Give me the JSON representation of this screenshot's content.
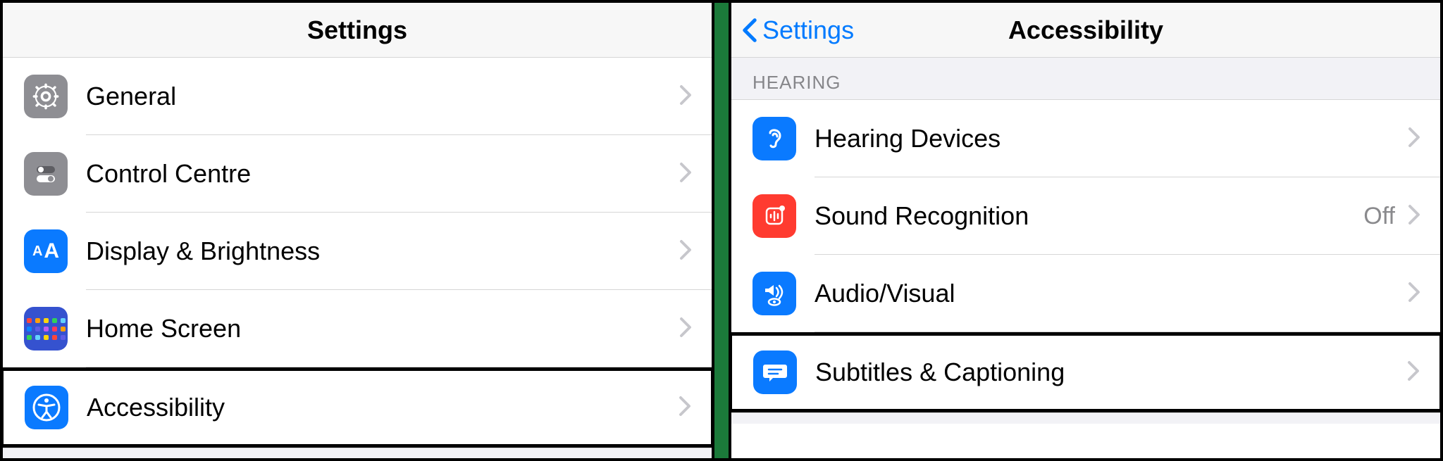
{
  "left": {
    "title": "Settings",
    "rows": [
      {
        "key": "general",
        "label": "General",
        "icon": "gear-icon",
        "bg": "#8e8e93"
      },
      {
        "key": "control-centre",
        "label": "Control Centre",
        "icon": "toggles-icon",
        "bg": "#8e8e93"
      },
      {
        "key": "display-brightness",
        "label": "Display & Brightness",
        "icon": "aa-icon",
        "bg": "#0a7aff"
      },
      {
        "key": "home-screen",
        "label": "Home Screen",
        "icon": "home-grid-icon",
        "bg": "#3552cf"
      },
      {
        "key": "accessibility",
        "label": "Accessibility",
        "icon": "accessibility-icon",
        "bg": "#0a7aff",
        "highlight": true
      }
    ]
  },
  "right": {
    "back_label": "Settings",
    "title": "Accessibility",
    "section": "HEARING",
    "rows": [
      {
        "key": "hearing-devices",
        "label": "Hearing Devices",
        "icon": "ear-icon",
        "bg": "#0a7aff"
      },
      {
        "key": "sound-recognition",
        "label": "Sound Recognition",
        "icon": "sound-icon",
        "bg": "#ff3b30",
        "value": "Off"
      },
      {
        "key": "audio-visual",
        "label": "Audio/Visual",
        "icon": "audio-visual-icon",
        "bg": "#0a7aff"
      },
      {
        "key": "subtitles-captioning",
        "label": "Subtitles & Captioning",
        "icon": "subtitles-icon",
        "bg": "#0a7aff",
        "highlight": true
      }
    ]
  }
}
